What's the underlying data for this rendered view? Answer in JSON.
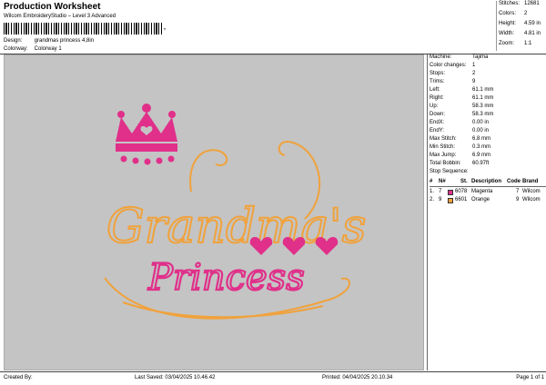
{
  "header": {
    "title": "Production Worksheet",
    "subtitle": "Wilcom EmbroideryStudio – Level 3 Advanced",
    "barcode_tail": ",",
    "design_label": "Design:",
    "design_value": "grandmas princess 4,8in",
    "colorway_label": "Colorway:",
    "colorway_value": "Colorway 1"
  },
  "stats": [
    {
      "label": "Stitches:",
      "value": "12681"
    },
    {
      "label": "Colors:",
      "value": "2"
    },
    {
      "label": "Height:",
      "value": "4.59 in"
    },
    {
      "label": "Width:",
      "value": "4.81 in"
    },
    {
      "label": "Zoom:",
      "value": "1:1"
    }
  ],
  "design": {
    "line1": "Grandma's",
    "line2": "Princess",
    "colors": {
      "magenta": "#e0308a",
      "orange": "#f0a23c",
      "canvas": "#c4c4c4"
    }
  },
  "machine": [
    {
      "label": "Machine:",
      "value": "Tajima"
    },
    {
      "label": "Color changes:",
      "value": "1"
    },
    {
      "label": "Stops:",
      "value": "2"
    },
    {
      "label": "Trims:",
      "value": "9"
    },
    {
      "label": "Left:",
      "value": "61.1 mm"
    },
    {
      "label": "Right:",
      "value": "61.1 mm"
    },
    {
      "label": "Up:",
      "value": "58.3 mm"
    },
    {
      "label": "Down:",
      "value": "58.3 mm"
    },
    {
      "label": "EndX:",
      "value": "0.00 in"
    },
    {
      "label": "EndY:",
      "value": "0.00 in"
    },
    {
      "label": "Max Stitch:",
      "value": "6.8 mm"
    },
    {
      "label": "Min Stitch:",
      "value": "0.3 mm"
    },
    {
      "label": "Max Jump:",
      "value": "6.9 mm"
    },
    {
      "label": "Total Bobbin:",
      "value": "60.97ft"
    }
  ],
  "stop_sequence": {
    "title": "Stop Sequence:",
    "headers": [
      "#",
      "N#",
      "St.",
      "Description",
      "Code",
      "Brand"
    ],
    "rows": [
      {
        "idx": "1.",
        "n": "7",
        "st": "6078",
        "desc": "Magenta",
        "code": "7",
        "brand": "Wilcom",
        "color": "#e0308a"
      },
      {
        "idx": "2.",
        "n": "9",
        "st": "6601",
        "desc": "Orange",
        "code": "9",
        "brand": "Wilcom",
        "color": "#f0a23c"
      }
    ]
  },
  "footer": {
    "created": "Created By:",
    "saved": "Last Saved: 03/04/2025 10.46.42",
    "printed": "Printed: 04/04/2025 20.10.34",
    "page": "Page 1 of 1"
  }
}
